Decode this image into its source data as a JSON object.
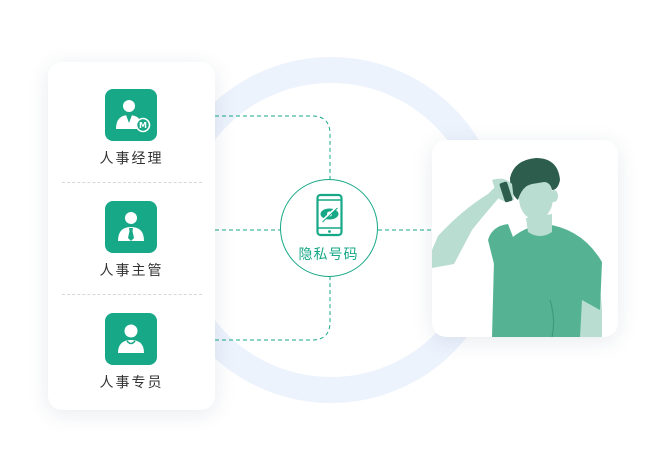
{
  "roles": [
    {
      "label": "人事经理",
      "icon": "manager-badge-icon"
    },
    {
      "label": "人事主管",
      "icon": "supervisor-tie-icon"
    },
    {
      "label": "人事专员",
      "icon": "specialist-person-icon"
    }
  ],
  "hub": {
    "label": "隐私号码",
    "icon": "privacy-phone-icon"
  },
  "colors": {
    "accent": "#17a887",
    "ring": "#eaf2fd",
    "shirt": "#55b394",
    "skin": "#b9ddd0",
    "hair": "#2c5d4d"
  }
}
